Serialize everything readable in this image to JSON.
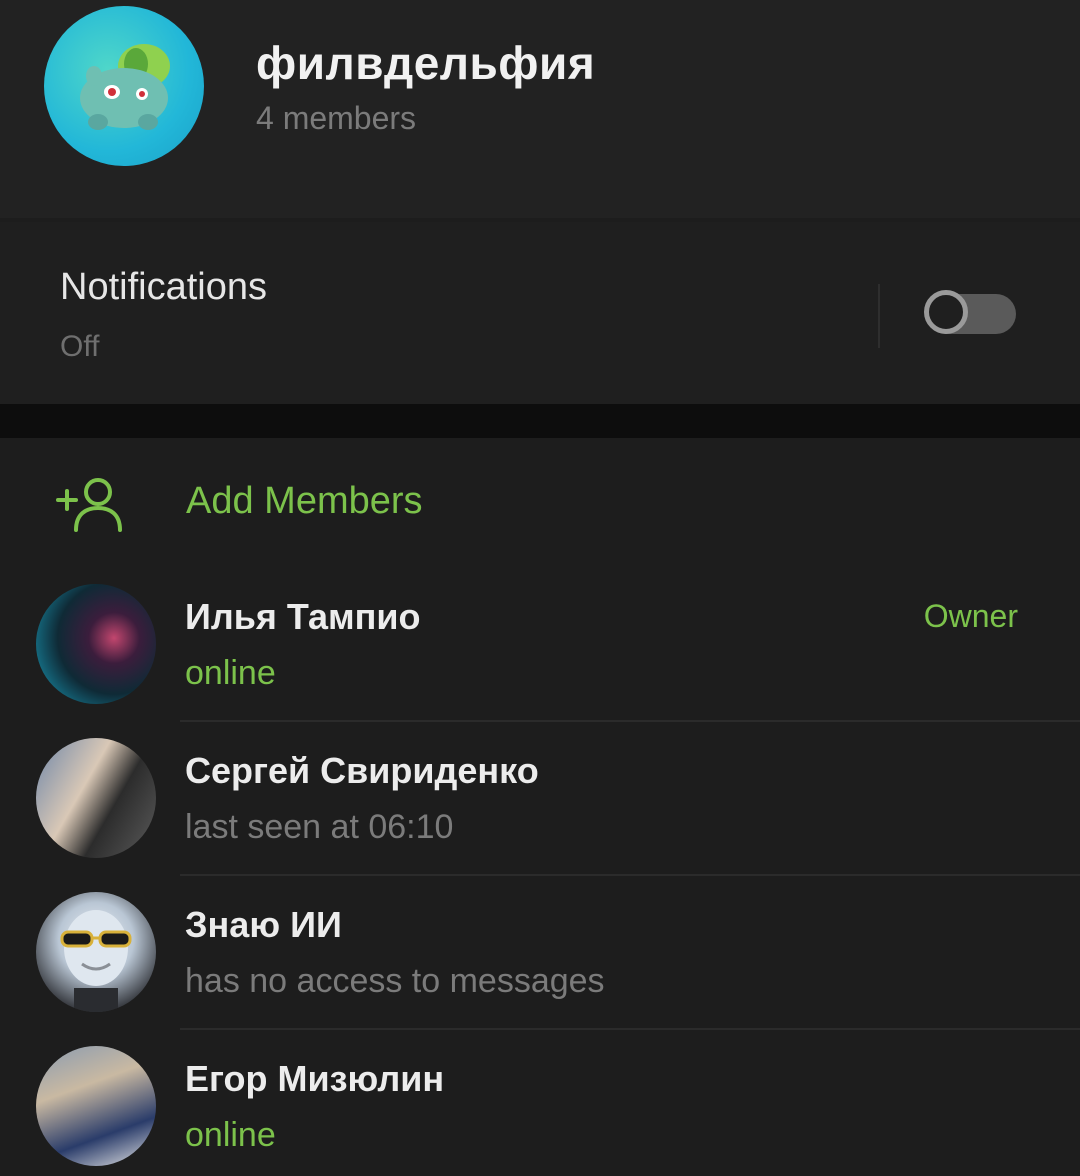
{
  "header": {
    "title": "филвдельфия",
    "subtitle": "4 members",
    "avatar_icon": "bulbasaur-avatar"
  },
  "notifications": {
    "title": "Notifications",
    "value": "Off",
    "toggle_on": false
  },
  "members_section": {
    "add_label": "Add Members",
    "add_icon": "add-user-icon",
    "members": [
      {
        "name": "Илья Тампио",
        "status": "online",
        "role": "Owner"
      },
      {
        "name": "Сергей Свириденко",
        "status": "last seen at 06:10",
        "role": ""
      },
      {
        "name": "Знаю ИИ",
        "status": "has no access to messages",
        "role": ""
      },
      {
        "name": "Егор Мизюлин",
        "status": "online",
        "role": ""
      }
    ]
  },
  "colors": {
    "accent": "#7cc24b",
    "background": "#1d1d1d",
    "header_bg": "#222222",
    "muted_text": "#7b7b7b"
  }
}
